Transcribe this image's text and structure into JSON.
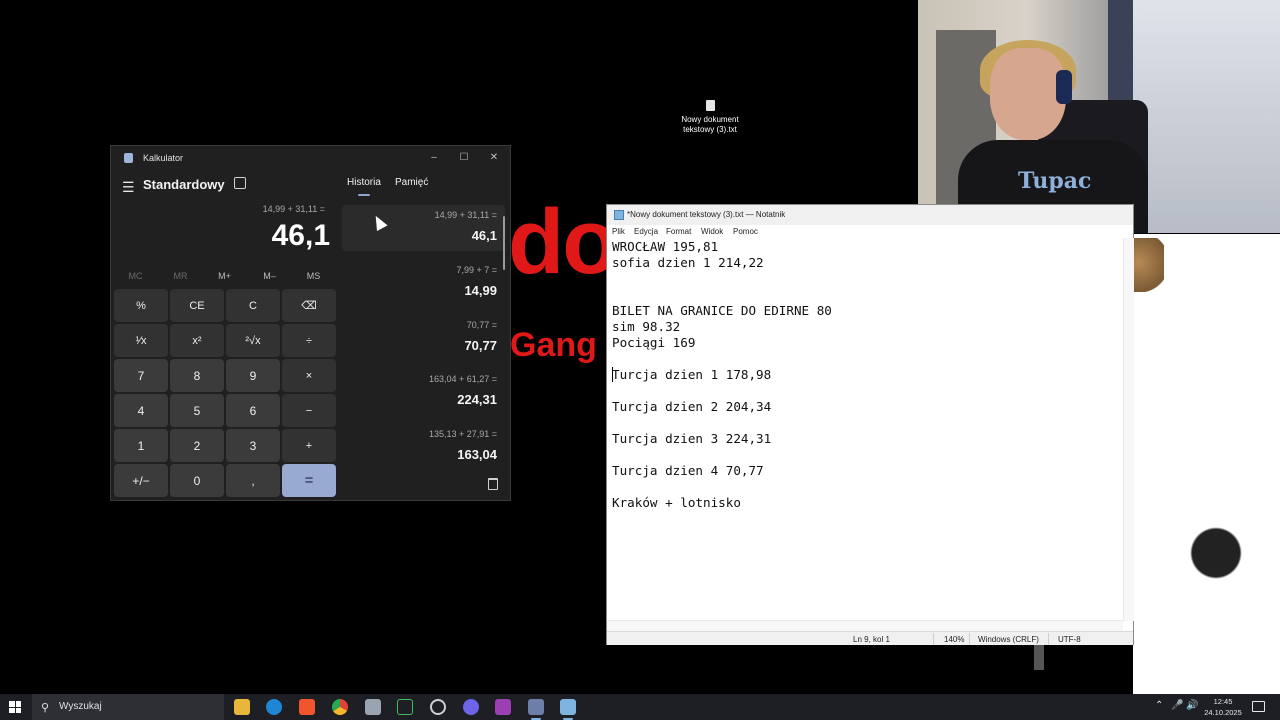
{
  "background": {
    "overlay_big": "do",
    "overlay_small": "Gang"
  },
  "desktop": {
    "icon_line1": "Nowy dokument",
    "icon_line2": "tekstowy (3).txt"
  },
  "webcam": {
    "shirt_print": "Tupac"
  },
  "calculator": {
    "title": "Kalkulator",
    "mode": "Standardowy",
    "expression": "14,99 + 31,11 =",
    "display": "46,1",
    "memory": [
      "MC",
      "MR",
      "M+",
      "M–",
      "MS"
    ],
    "keys": [
      [
        "%",
        "CE",
        "C",
        "⌫"
      ],
      [
        "¹⁄x",
        "x²",
        "²√x",
        "÷"
      ],
      [
        "7",
        "8",
        "9",
        "×"
      ],
      [
        "4",
        "5",
        "6",
        "−"
      ],
      [
        "1",
        "2",
        "3",
        "+"
      ],
      [
        "+/−",
        "0",
        ",",
        "="
      ]
    ],
    "tabs": {
      "history": "Historia",
      "memory": "Pamięć"
    },
    "history": [
      {
        "expr": "14,99   +   31,11 =",
        "result": "46,1"
      },
      {
        "expr": "7,99   +   7 =",
        "result": "14,99"
      },
      {
        "expr": "70,77 =",
        "result": "70,77"
      },
      {
        "expr": "163,04   +   61,27 =",
        "result": "224,31"
      },
      {
        "expr": "135,13   +   27,91 =",
        "result": "163,04"
      }
    ]
  },
  "notepad": {
    "title": "*Nowy dokument tekstowy (3).txt — Notatnik",
    "menu": [
      "Plik",
      "Edycja",
      "Format",
      "Widok",
      "Pomoc"
    ],
    "lines": [
      "WROCŁAW 195,81",
      "sofia dzien 1 214,22",
      "",
      "",
      "BILET NA GRANICE DO EDIRNE 80",
      "sim 98.32",
      "Pociągi 169",
      "",
      "Turcja dzien 1 178,98",
      "",
      "Turcja dzien 2 204,34",
      "",
      "Turcja dzien 3 224,31",
      "",
      "Turcja dzien 4 70,77",
      "",
      "Kraków + lotnisko"
    ],
    "status": {
      "position": "Ln 9, kol 1",
      "zoom": "140%",
      "line_endings": "Windows (CRLF)",
      "encoding": "UTF-8"
    }
  },
  "taskbar": {
    "search_label": "Wyszukaj",
    "time": "12:45",
    "date": "24.10.2025",
    "apps": [
      "file-explorer",
      "edge",
      "brave",
      "chrome",
      "app",
      "terminal",
      "app",
      "discord",
      "app",
      "calculator",
      "notepad"
    ]
  }
}
